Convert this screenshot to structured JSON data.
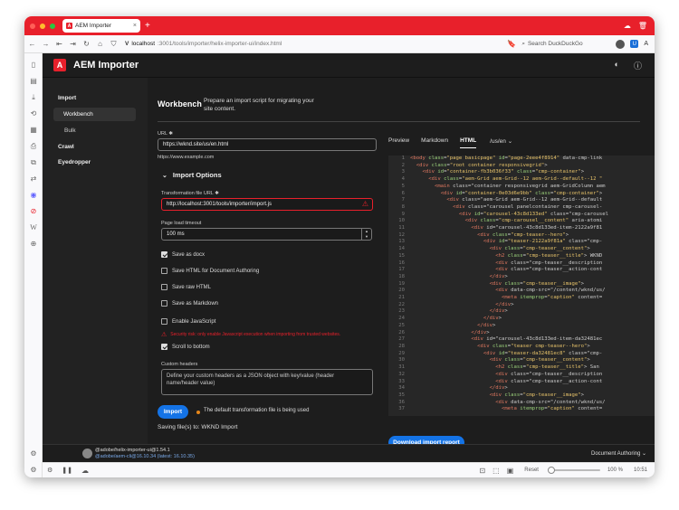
{
  "browser": {
    "tab_title": "AEM Importer",
    "url_host": "localhost",
    "url_path": ":3001/tools/importer/helix-importer-ui/index.html",
    "search_placeholder": "Search DuckDuckGo"
  },
  "app": {
    "title": "AEM Importer"
  },
  "sidenav": {
    "import": "Import",
    "workbench": "Workbench",
    "bulk": "Bulk",
    "crawl": "Crawl",
    "eyedropper": "Eyedropper"
  },
  "workbench": {
    "title": "Workbench",
    "description": "Prepare an import script for migrating your site content.",
    "url_label": "URL",
    "url_value": "https://wknd.site/us/en.html",
    "url_help": "https://www.example.com",
    "import_options": "Import Options",
    "transform_label": "Transformation file URL",
    "transform_value": "http://localhost:3001/tools/importer/import.js",
    "timeout_label": "Page load timeout",
    "timeout_value": "100 ms",
    "checkboxes": [
      {
        "label": "Save as docx",
        "checked": true
      },
      {
        "label": "Save HTML for Document Authoring",
        "checked": false
      },
      {
        "label": "Save raw HTML",
        "checked": false
      },
      {
        "label": "Save as Markdown",
        "checked": false
      },
      {
        "label": "Enable JavaScript",
        "checked": false
      },
      {
        "label": "Scroll to bottom",
        "checked": true
      }
    ],
    "js_warning": "Security risk: only enable Javascript execution when importing from trusted websites.",
    "headers_label": "Custom headers",
    "headers_placeholder": "Define your custom headers as a JSON object with key/value (header name/header value)",
    "import_button": "Import",
    "status_text": "The default transformation file is being used",
    "saving_text": "Saving file(s) to: WKND Import"
  },
  "preview": {
    "tabs": [
      "Preview",
      "Markdown",
      "HTML"
    ],
    "active_tab": "HTML",
    "path_select": "/us/en",
    "download_button": "Download import report",
    "code_lines": [
      "<body class=\"page basicpage\" id=\"page-2eee4f8914\" data-cmp-link",
      "  <div class=\"root container responsivegrid\">",
      "    <div id=\"container-fb3b036f33\" class=\"cmp-container\">",
      "      <div class=\"aem-Grid aem-Grid--12 aem-Grid--default--12 \"",
      "        <main class=\"container responsivegrid aem-GridColumn aem",
      "          <div id=\"container-0e03d6e9bb\" class=\"cmp-container\">",
      "            <div class=\"aem-Grid aem-Grid--12 aem-Grid--default",
      "              <div class=\"carousel panelcontainer cmp-carousel-",
      "                <div id=\"carousel-43c8d133ed\" class=\"cmp-carousel",
      "                  <div class=\"cmp-carousel__content\" aria-atomi",
      "                    <div id=\"carousel-43c8d133ed-item-2122a9f81",
      "                      <div class=\"cmp-teaser--hero\">",
      "                        <div id=\"teaser-2122a9f81a\" class=\"cmp-",
      "                          <div class=\"cmp-teaser__content\">",
      "                            <h2 class=\"cmp-teaser__title\"> WKND",
      "                            <div class=\"cmp-teaser__description",
      "                            <div class=\"cmp-teaser__action-cont",
      "                          </div>",
      "                          <div class=\"cmp-teaser__image\">",
      "                            <div data-cmp-src=\"/content/wknd/us/",
      "                              <meta itemprop=\"caption\" content=",
      "                            </div>",
      "                          </div>",
      "                        </div>",
      "                      </div>",
      "                    </div>",
      "                    <div id=\"carousel-43c8d133ed-item-da32481ec",
      "                      <div class=\"teaser cmp-teaser--hero\">",
      "                        <div id=\"teaser-da32481ec8\" class=\"cmp-",
      "                          <div class=\"cmp-teaser__content\">",
      "                            <h2 class=\"cmp-teaser__title\"> San",
      "                            <div class=\"cmp-teaser__description",
      "                            <div class=\"cmp-teaser__action-cont",
      "                          </div>",
      "                          <div class=\"cmp-teaser__image\">",
      "                            <div data-cmp-src=\"/content/wknd/us/",
      "                              <meta itemprop=\"caption\" content="
    ]
  },
  "footer": {
    "user": "@adobe/helix-importer-ui@1.54.1",
    "cli": "@adobe/aem-cli@16.10.34 (latest: 16.10.35)",
    "authoring": "Document Authoring"
  },
  "status": {
    "reset": "Reset",
    "zoom": "100 %",
    "time": "10:51"
  },
  "colors": {
    "accent": "#1473e6",
    "brand": "#e8202b",
    "warning": "#e8202b",
    "status_dot": "#e68619"
  }
}
